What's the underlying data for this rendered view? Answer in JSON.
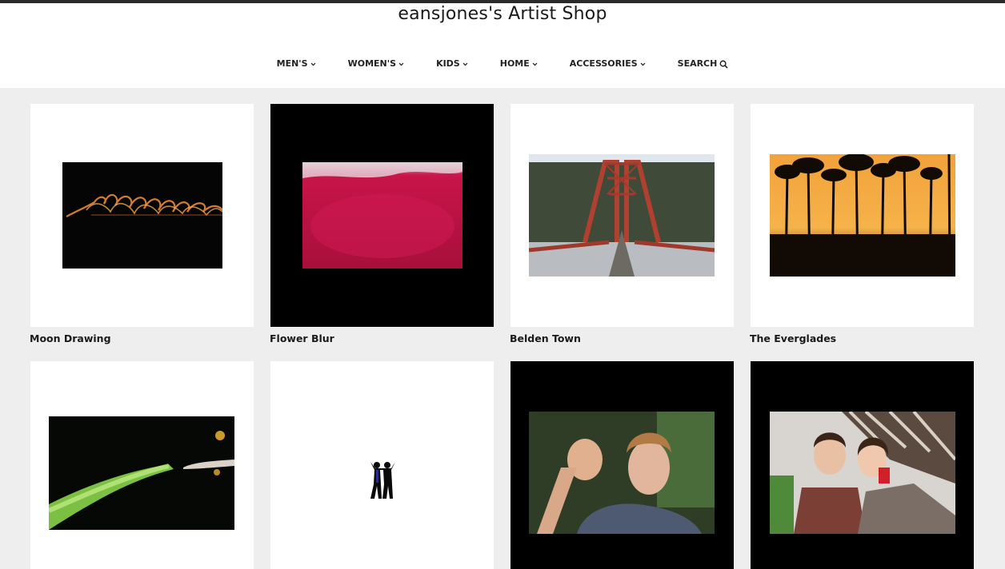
{
  "shop": {
    "title": "eansjones's Artist Shop"
  },
  "nav": {
    "items": [
      {
        "label": "MEN'S",
        "icon": "chevron-down-icon"
      },
      {
        "label": "WOMEN'S",
        "icon": "chevron-down-icon"
      },
      {
        "label": "KIDS",
        "icon": "chevron-down-icon"
      },
      {
        "label": "HOME",
        "icon": "chevron-down-icon"
      },
      {
        "label": "ACCESSORIES",
        "icon": "chevron-down-icon"
      },
      {
        "label": "SEARCH",
        "icon": "search-icon"
      }
    ]
  },
  "products": [
    {
      "title": "Moon Drawing",
      "background": "#ffffff"
    },
    {
      "title": "Flower Blur",
      "background": "#000000"
    },
    {
      "title": "Belden Town",
      "background": "#ffffff"
    },
    {
      "title": "The Everglades",
      "background": "#ffffff"
    },
    {
      "title": "",
      "background": "#ffffff"
    },
    {
      "title": "",
      "background": "#ffffff"
    },
    {
      "title": "",
      "background": "#000000"
    },
    {
      "title": "",
      "background": "#000000"
    }
  ]
}
